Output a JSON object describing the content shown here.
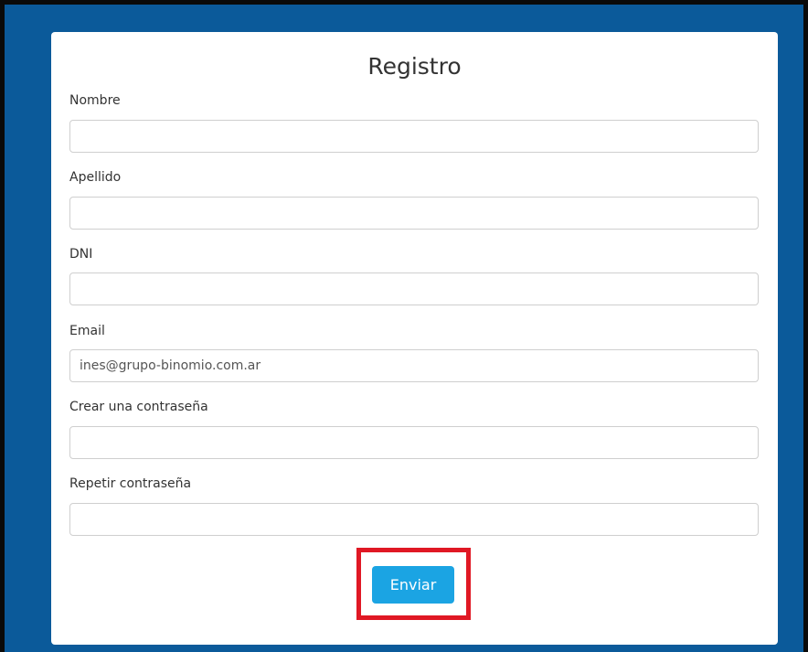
{
  "form": {
    "title": "Registro",
    "fields": [
      {
        "label": "Nombre",
        "value": ""
      },
      {
        "label": "Apellido",
        "value": ""
      },
      {
        "label": "DNI",
        "value": ""
      },
      {
        "label": "Email",
        "value": "ines@grupo-binomio.com.ar"
      },
      {
        "label": "Crear una contraseña",
        "value": ""
      },
      {
        "label": "Repetir contraseña",
        "value": ""
      }
    ],
    "submit_label": "Enviar"
  },
  "colors": {
    "background": "#0b5a9a",
    "button": "#1ba4e3",
    "highlight": "#e01824"
  }
}
